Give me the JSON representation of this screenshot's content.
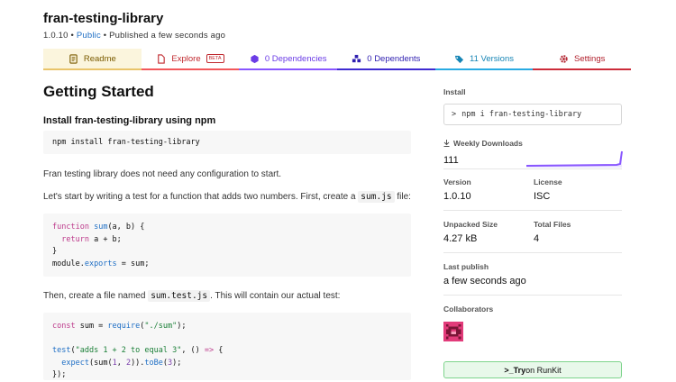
{
  "package": {
    "name": "fran-testing-library",
    "version": "1.0.10",
    "sep1": " • ",
    "visibility": "Public",
    "sep2": " • ",
    "published": "Published a few seconds ago"
  },
  "tabs": [
    {
      "label": "Readme",
      "icon": "readme-icon"
    },
    {
      "label": "Explore",
      "badge": "BETA",
      "icon": "explore-icon"
    },
    {
      "label": "0 Dependencies",
      "icon": "box-icon"
    },
    {
      "label": "0 Dependents",
      "icon": "cubes-icon"
    },
    {
      "label": "11 Versions",
      "icon": "tag-icon"
    },
    {
      "label": "Settings",
      "icon": "gear-icon"
    }
  ],
  "readme": {
    "heading": "Getting Started",
    "install_heading": "Install fran-testing-library using npm",
    "install_cmd": "npm install fran-testing-library",
    "p1": "Fran testing library does not need any configuration to start.",
    "p2_pre": "Let's start by writing a test for a function that adds two numbers. First, create a ",
    "p2_code": "sum.js",
    "p2_post": " file:",
    "code1": {
      "l1_kw": "function",
      "l1_fn": "sum",
      "l1_rest": "(a, b) {",
      "l2_kw": "return",
      "l2_rest": " a + b;",
      "l3": "}",
      "l4_a": "module.",
      "l4_b": "exports",
      "l4_c": " = sum;"
    },
    "p3_pre": "Then, create a file named ",
    "p3_code": "sum.test.js",
    "p3_post": ". This will contain our actual test:",
    "code2": {
      "l1_kw": "const",
      "l1_a": " sum = ",
      "l1_fn": "require",
      "l1_b": "(",
      "l1_str": "\"./sum\"",
      "l1_c": ");",
      "l3_fn": "test",
      "l3_a": "(",
      "l3_str": "\"adds 1 + 2 to equal 3\"",
      "l3_b": ", () ",
      "l3_kw": "=>",
      "l3_c": " {",
      "l4_fn": "expect",
      "l4_a": "(sum(",
      "l4_n1": "1",
      "l4_b": ", ",
      "l4_n2": "2",
      "l4_c": ")).",
      "l4_fn2": "toBe",
      "l4_d": "(",
      "l4_n3": "3",
      "l4_e": ");",
      "l5": "});"
    }
  },
  "sidebar": {
    "install_label": "Install",
    "install_prompt": ">",
    "install_cmd": "npm i fran-testing-library",
    "weekly_icon": "download-icon",
    "weekly_label": "Weekly Downloads",
    "weekly_value": "111",
    "version_label": "Version",
    "version_value": "1.0.10",
    "license_label": "License",
    "license_value": "ISC",
    "unpacked_label": "Unpacked Size",
    "unpacked_value": "4.27 kB",
    "files_label": "Total Files",
    "files_value": "4",
    "publish_label": "Last publish",
    "publish_value": "a few seconds ago",
    "collab_label": "Collaborators",
    "runkit_prefix": ">_",
    "runkit_bold": "Try",
    "runkit_rest": " on RunKit"
  },
  "colors": {
    "accent_purple": "#8956ff",
    "public_blue": "#1f6fc5",
    "runkit_green": "#7ed48c"
  }
}
